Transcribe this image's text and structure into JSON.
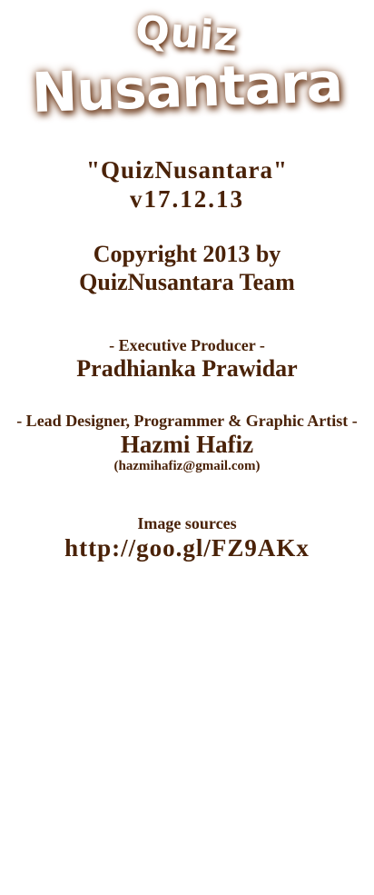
{
  "logo": {
    "line1": "Quiz",
    "line2": "Nusantara"
  },
  "app_name": "\"QuizNusantara\"",
  "version": "v17.12.13",
  "copyright_line1": "Copyright 2013 by",
  "copyright_line2": "QuizNusantara Team",
  "executive_producer": {
    "role": "- Executive Producer -",
    "name": "Pradhianka Prawidar"
  },
  "lead_designer": {
    "role": "- Lead Designer, Programmer & Graphic Artist -",
    "name": "Hazmi Hafiz",
    "email": "(hazmihafiz@gmail.com)"
  },
  "image_sources": {
    "label": "Image sources",
    "link": "http://goo.gl/FZ9AKx"
  },
  "colors": {
    "text": "#4a2208",
    "logo_shadow": "#6b3a1c"
  }
}
